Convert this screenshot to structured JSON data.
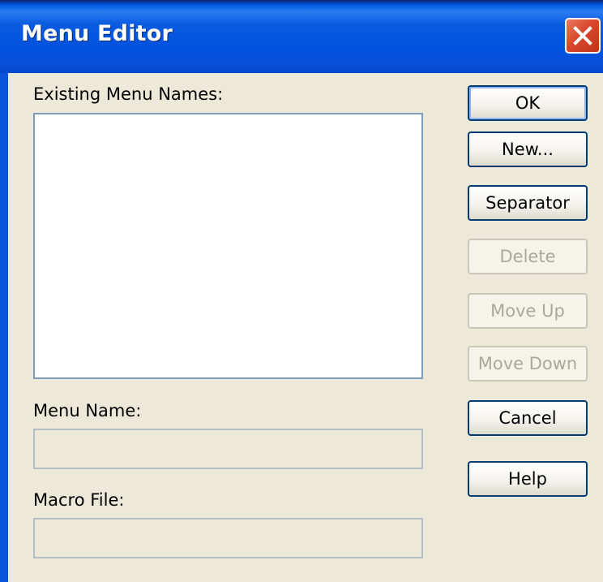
{
  "window": {
    "title": "Menu Editor"
  },
  "labels": {
    "existing_menu_names": "Existing Menu Names:",
    "menu_name": "Menu Name:",
    "macro_file": "Macro File:"
  },
  "fields": {
    "menu_name_value": "",
    "macro_file_value": ""
  },
  "buttons": {
    "ok": "OK",
    "new": "New...",
    "separator": "Separator",
    "delete": "Delete",
    "move_up": "Move Up",
    "move_down": "Move Down",
    "cancel": "Cancel",
    "help": "Help"
  },
  "colors": {
    "title_bar": "#0a55dc",
    "close_button": "#d9472b",
    "dialog_bg": "#ece9d8"
  }
}
